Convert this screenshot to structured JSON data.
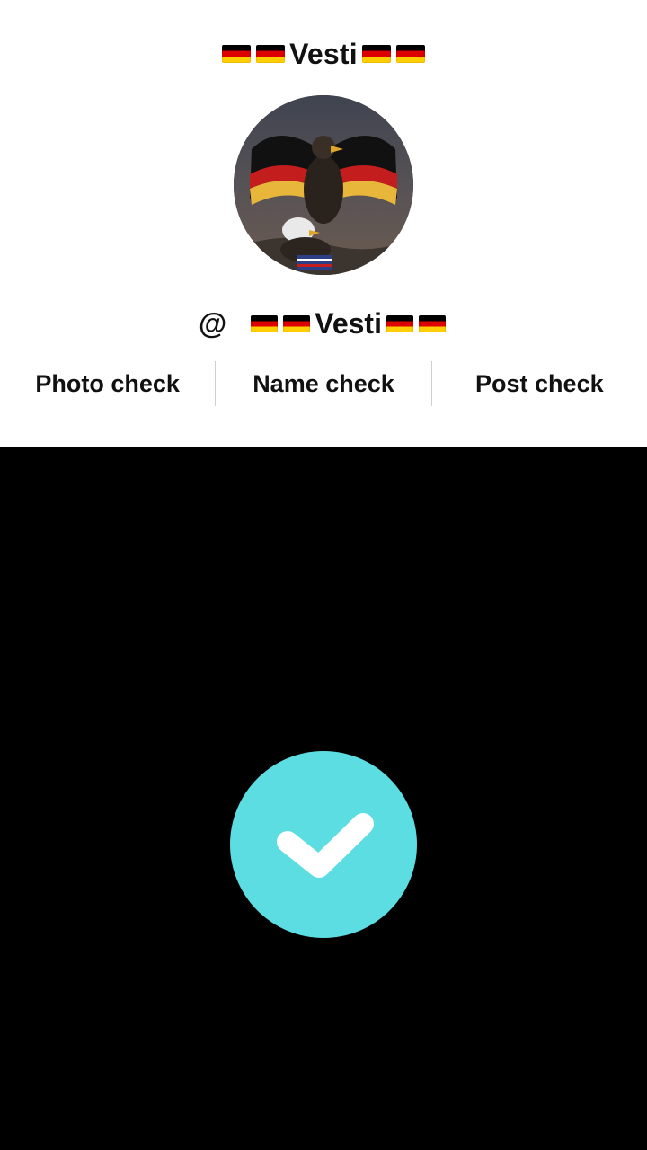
{
  "header": {
    "name": "Vesti"
  },
  "profile": {
    "handle_prefix": "@",
    "handle_name": "Vesti"
  },
  "tabs": [
    {
      "label": "Photo check"
    },
    {
      "label": "Name check"
    },
    {
      "label": "Post check"
    }
  ],
  "colors": {
    "top_background": "#ffffff",
    "bottom_background": "#000000",
    "check_circle": "#5cdde2",
    "check_mark": "#ffffff"
  },
  "icons": {
    "flag": "germany-flag-icon",
    "check": "checkmark-icon"
  }
}
